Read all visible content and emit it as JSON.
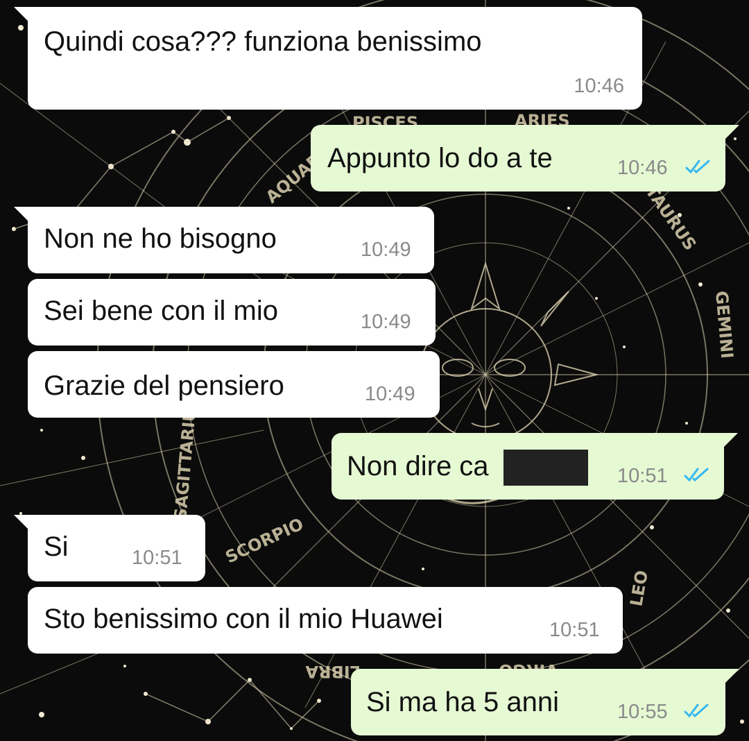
{
  "conversation": {
    "colors": {
      "incoming_bubble": "#ffffff",
      "outgoing_bubble": "#e5f9d3",
      "read_ticks": "#34b7f1",
      "wallpaper": "#0b0b0b",
      "wallpaper_lines": "#d9cfae"
    },
    "wallpaper_labels": [
      "PISCES",
      "ARIES",
      "AQUARIUS",
      "TAURUS",
      "GEMINI",
      "SAGITTARIUS",
      "SCORPIO",
      "LEO",
      "LIBRA",
      "VIRGO"
    ],
    "messages": [
      {
        "direction": "incoming",
        "text": "Quindi cosa??? funziona benissimo",
        "time": "10:46"
      },
      {
        "direction": "outgoing",
        "text": "Appunto lo do a te",
        "time": "10:46",
        "status": "read"
      },
      {
        "direction": "incoming",
        "text": "Non ne ho bisogno",
        "time": "10:49"
      },
      {
        "direction": "incoming",
        "text": "Sei bene con il mio",
        "time": "10:49"
      },
      {
        "direction": "incoming",
        "text": "Grazie del pensiero",
        "time": "10:49"
      },
      {
        "direction": "outgoing",
        "text": "Non dire ca",
        "time": "10:51",
        "status": "read",
        "redacted": true
      },
      {
        "direction": "incoming",
        "text": "Si",
        "time": "10:51"
      },
      {
        "direction": "incoming",
        "text": "Sto benissimo con il mio Huawei",
        "time": "10:51"
      },
      {
        "direction": "outgoing",
        "text": "Si ma ha 5 anni",
        "time": "10:55",
        "status": "read"
      }
    ]
  }
}
